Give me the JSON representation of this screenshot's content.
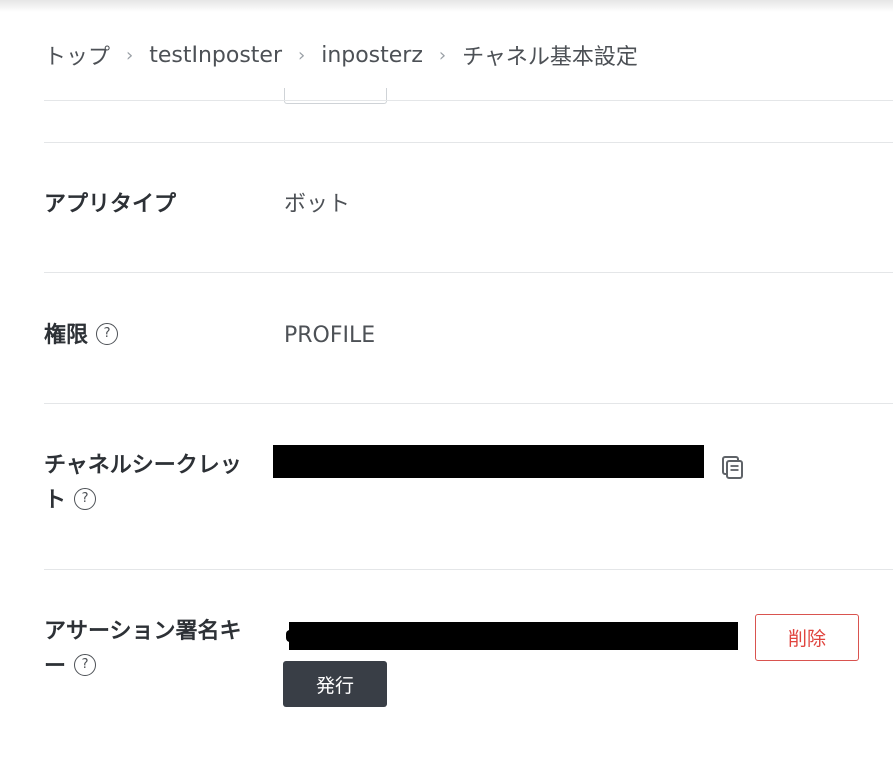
{
  "breadcrumb": {
    "items": [
      "トップ",
      "testInposter",
      "inposterz",
      "チャネル基本設定"
    ],
    "separator": "›"
  },
  "rows": {
    "app_type": {
      "label": "アプリタイプ",
      "value": "ボット"
    },
    "permissions": {
      "label": "権限",
      "value": "PROFILE",
      "help": "?"
    },
    "channel_secret": {
      "label_line1": "チャネルシークレッ",
      "label_line2": "ト",
      "help": "?"
    },
    "assertion_key": {
      "label_line1": "アサーション署名キ",
      "label_line2": "ー",
      "help": "?"
    }
  },
  "buttons": {
    "delete": "削除",
    "issue": "発行"
  },
  "icons": {
    "copy": "copy-icon",
    "help": "question-circle-icon",
    "separator": "chevron-right-icon"
  },
  "colors": {
    "text": "#2d3136",
    "muted": "#4d5156",
    "danger": "#e0443e",
    "dark_button": "#393e46",
    "divider": "#e4e6e8"
  }
}
